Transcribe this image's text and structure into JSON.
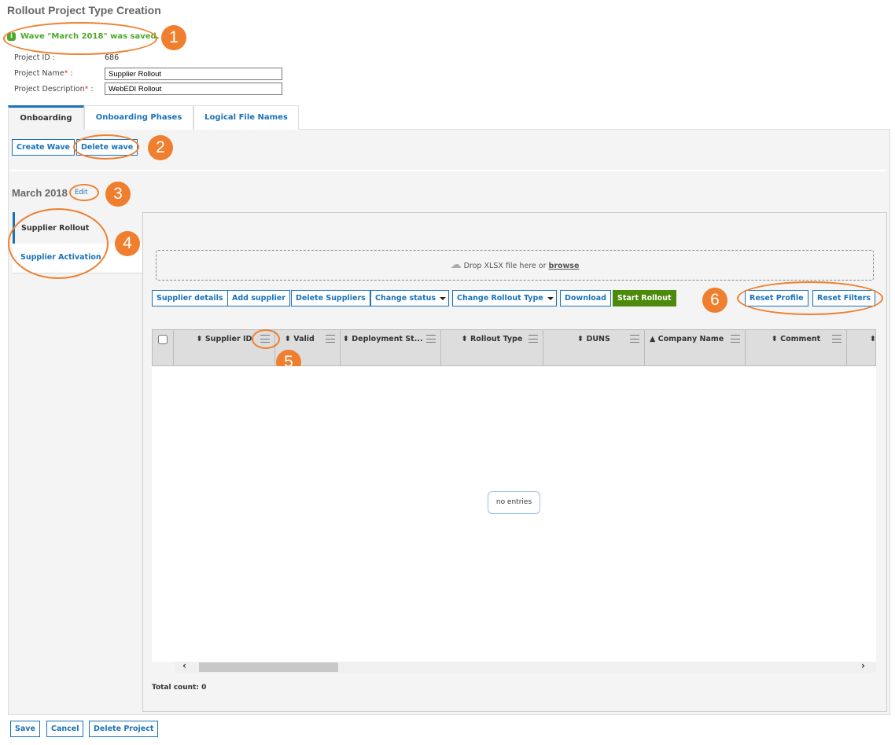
{
  "title": "Rollout Project Type Creation",
  "message": "Wave \"March 2018\" was saved.",
  "fields": {
    "id_label": "Project ID :",
    "id_value": "686",
    "name_label": "Project Name",
    "name_value": "Supplier Rollout",
    "desc_label": "Project Description",
    "desc_value": "WebEDI Rollout",
    "required": "*",
    "colon": ":"
  },
  "tabs": [
    "Onboarding",
    "Onboarding Phases",
    "Logical File Names"
  ],
  "wave_buttons": {
    "create": "Create Wave",
    "delete": "Delete wave"
  },
  "wave": {
    "name": "March 2018",
    "edit": "Edit"
  },
  "side_nav": [
    "Supplier Rollout",
    "Supplier Activation"
  ],
  "dropzone": {
    "text": "Drop XLSX file here or",
    "link": "browse"
  },
  "toolbar": {
    "details": "Supplier details",
    "add": "Add supplier",
    "delete": "Delete Suppliers",
    "status": "Change status",
    "rollout_type": "Change Rollout Type",
    "download": "Download",
    "start": "Start Rollout",
    "reset_profile": "Reset Profile",
    "reset_filters": "Reset Filters"
  },
  "columns": [
    "Supplier ID",
    "Valid",
    "Deployment St...",
    "Rollout Type",
    "DUNS",
    "Company Name",
    "Comment",
    ""
  ],
  "sort_glyphs": {
    "default": "⬍",
    "asc": "▲"
  },
  "empty": "no entries",
  "total": "Total count: 0",
  "footer": {
    "save": "Save",
    "cancel": "Cancel",
    "delete": "Delete Project"
  },
  "annotations": [
    "1",
    "2",
    "3",
    "4",
    "5",
    "6"
  ],
  "colors": {
    "accent": "#1a72b8",
    "success": "#4caa2a",
    "start": "#4b8a0a",
    "annotation": "#ef7f2f"
  }
}
